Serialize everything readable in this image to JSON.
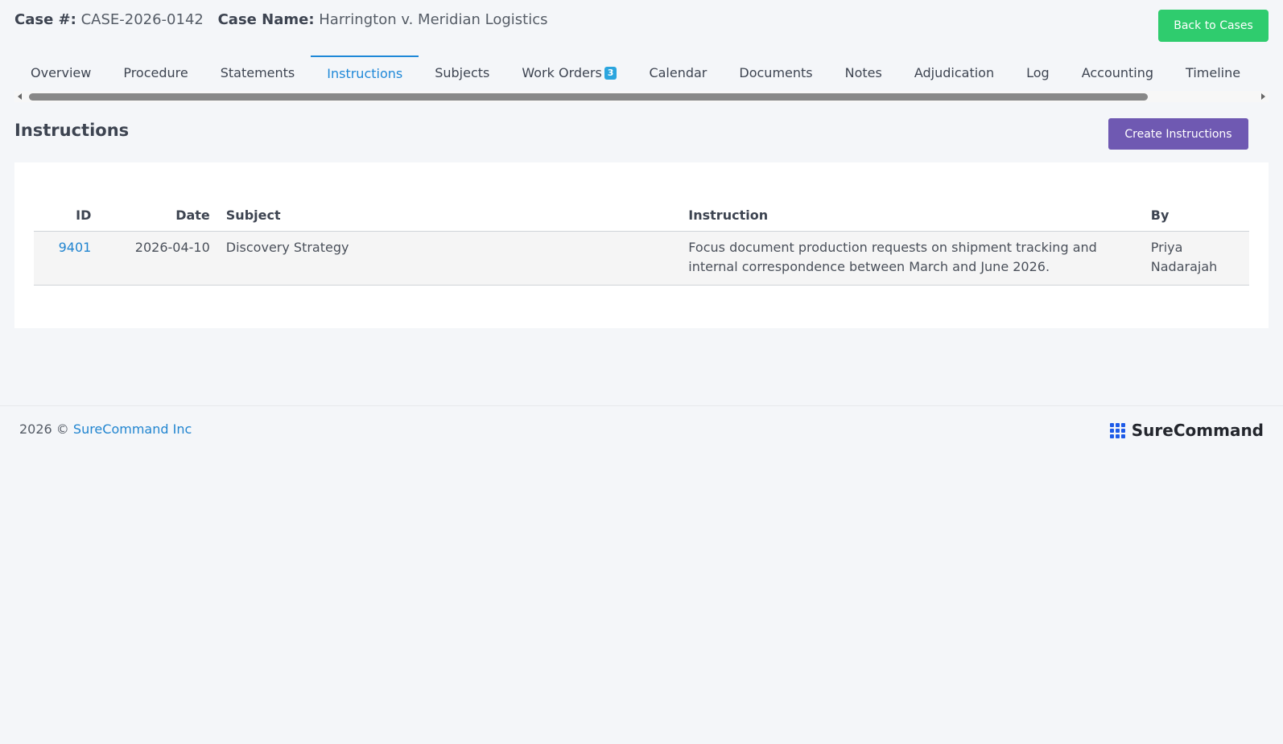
{
  "header": {
    "case_label": "Case #:",
    "case_number": "CASE-2026-0142",
    "name_label": "Case Name:",
    "case_name": "Harrington v. Meridian Logistics",
    "back_button": "Back to Cases"
  },
  "tabs": [
    {
      "label": "Overview"
    },
    {
      "label": "Procedure"
    },
    {
      "label": "Statements"
    },
    {
      "label": "Instructions",
      "active": true
    },
    {
      "label": "Subjects"
    },
    {
      "label": "Work Orders",
      "badge": "3"
    },
    {
      "label": "Calendar"
    },
    {
      "label": "Documents"
    },
    {
      "label": "Notes"
    },
    {
      "label": "Adjudication"
    },
    {
      "label": "Log"
    },
    {
      "label": "Accounting"
    },
    {
      "label": "Timeline"
    }
  ],
  "section": {
    "title": "Instructions",
    "create_button": "Create Instructions"
  },
  "table": {
    "columns": [
      "ID",
      "Date",
      "Subject",
      "Instruction",
      "By"
    ],
    "rows": [
      {
        "id": "9401",
        "date": "2026-04-10",
        "subject": "Discovery Strategy",
        "instruction": "Focus document production requests on shipment tracking and internal correspondence between March and June 2026.",
        "by": "Priya Nadarajah"
      }
    ]
  },
  "footer": {
    "copyright": "2026 ©",
    "company_link": "SureCommand Inc",
    "brand_name": "SureCommand"
  },
  "colors": {
    "accent": "#1e88d8",
    "back_button": "#2fcc6e",
    "create_button": "#6f59b2",
    "brand": "#1e5be8"
  }
}
